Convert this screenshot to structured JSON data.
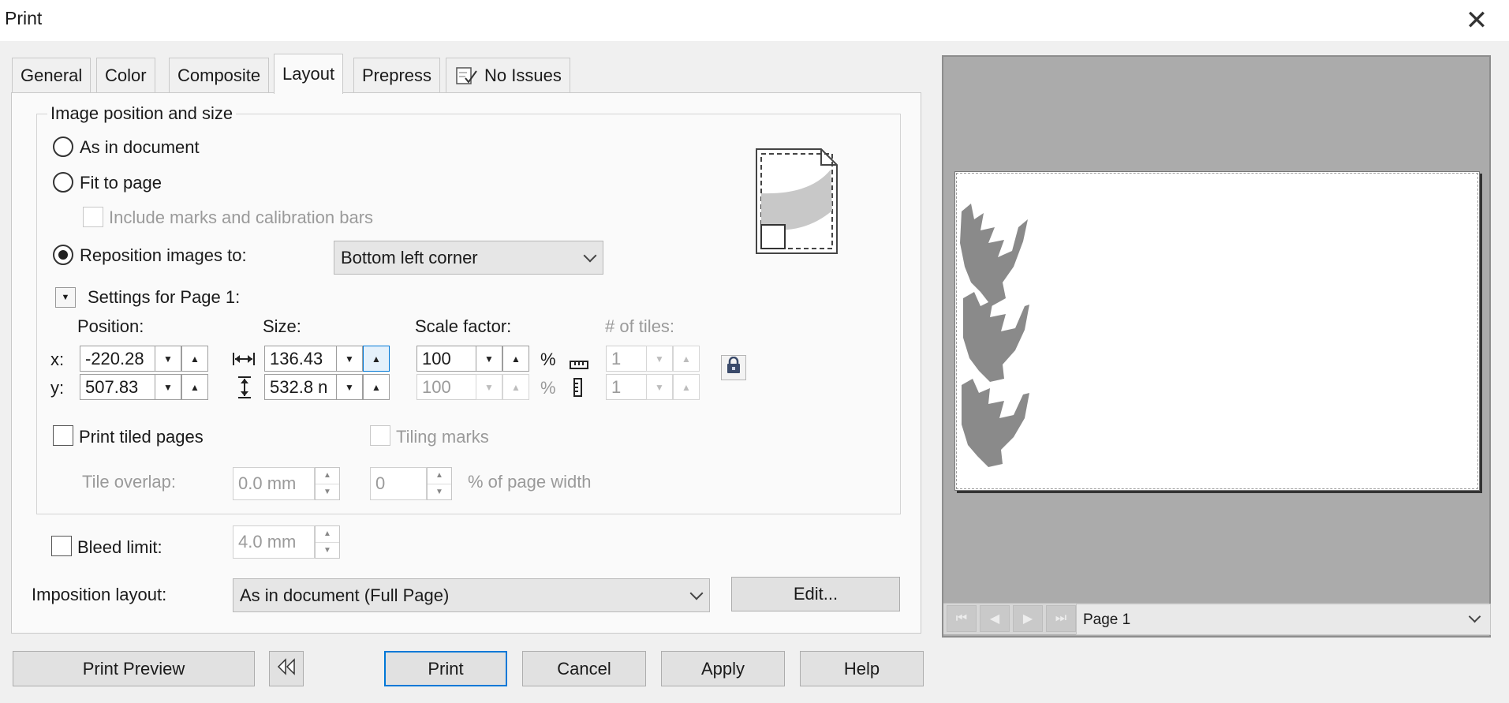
{
  "window": {
    "title": "Print"
  },
  "tabs": [
    {
      "label": "General"
    },
    {
      "label": "Color"
    },
    {
      "label": "Composite"
    },
    {
      "label": "Layout"
    },
    {
      "label": "Prepress"
    },
    {
      "label": "No Issues"
    }
  ],
  "active_tab": "Layout",
  "image_position": {
    "group_label": "Image position and size",
    "as_in_document": "As in document",
    "fit_to_page": "Fit to page",
    "include_marks": "Include marks and calibration bars",
    "reposition": "Reposition images to:",
    "selected_option": "Reposition images to:",
    "reposition_value": "Bottom left corner",
    "settings_label": "Settings for Page 1:"
  },
  "dimensions": {
    "position_header": "Position:",
    "size_header": "Size:",
    "scale_header": "Scale factor:",
    "tiles_header": "# of tiles:",
    "x_label": "x:",
    "y_label": "y:",
    "x_value": "-220.28",
    "y_value": "507.83",
    "width_value": "136.43",
    "height_value": "532.8 n",
    "scale_x": "100",
    "scale_y": "100",
    "percent_symbol": "%",
    "tiles_x": "1",
    "tiles_y": "1"
  },
  "tiling": {
    "print_tiled_pages": "Print tiled pages",
    "tiling_marks": "Tiling marks",
    "tile_overlap_label": "Tile overlap:",
    "tile_overlap_value": "0.0 mm",
    "overlap_percent_value": "0",
    "percent_of_page_width": "% of page width"
  },
  "bleed": {
    "label": "Bleed limit:",
    "value": "4.0 mm"
  },
  "imposition": {
    "label": "Imposition layout:",
    "value": "As in document (Full Page)",
    "edit_button": "Edit..."
  },
  "buttons": {
    "print_preview": "Print Preview",
    "print": "Print",
    "cancel": "Cancel",
    "apply": "Apply",
    "help": "Help"
  },
  "preview": {
    "page_select": "Page 1"
  },
  "icons": {
    "close": "close-icon",
    "issues": "checklist-icon",
    "lock": "lock-icon",
    "collapse_preview": "double-chevron-left-icon"
  },
  "colors": {
    "accent": "#0078d7",
    "dialog_bg": "#f0f0f0",
    "preview_bg": "#ababab"
  }
}
